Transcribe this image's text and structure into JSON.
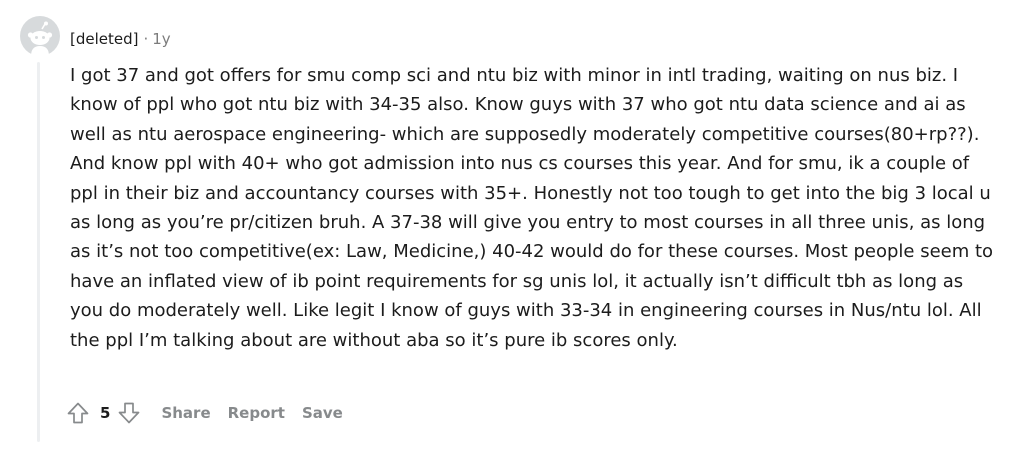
{
  "comment": {
    "author": "[deleted]",
    "separator": "·",
    "age": "1y",
    "body": "I got 37 and got offers for smu comp sci and ntu biz with minor in intl trading, waiting on nus biz. I know of ppl who got ntu biz with 34-35 also. Know guys with 37 who got ntu data science and ai as well as ntu aerospace engineering- which are supposedly moderately competitive courses(80+rp??). And know ppl with 40+ who got admission into nus cs courses this year. And for smu, ik a couple of ppl in their biz and accountancy courses with 35+. Honestly not too tough to get into the big 3 local u as long as you’re pr/citizen bruh. A 37-38 will give you entry to most courses in all three unis, as long as it’s not too competitive(ex: Law, Medicine,) 40-42 would do for these courses. Most people seem to have an inflated view of ib point requirements for sg unis lol, it actually isn’t difficult tbh as long as you do moderately well. Like legit I know of guys with 33-34 in engineering courses in Nus/ntu lol. All the ppl I’m talking about are without aba so it’s pure ib scores only.",
    "score": "5"
  },
  "actions": {
    "share_label": "Share",
    "report_label": "Report",
    "save_label": "Save"
  },
  "icons": {
    "avatar": "deleted-user-avatar-icon",
    "upvote": "upvote-arrow-icon",
    "downvote": "downvote-arrow-icon"
  },
  "colors": {
    "text": "#1c1c1c",
    "muted": "#878a8c",
    "avatar_bg": "#d7dadc",
    "thread_line": "#edeff1"
  }
}
